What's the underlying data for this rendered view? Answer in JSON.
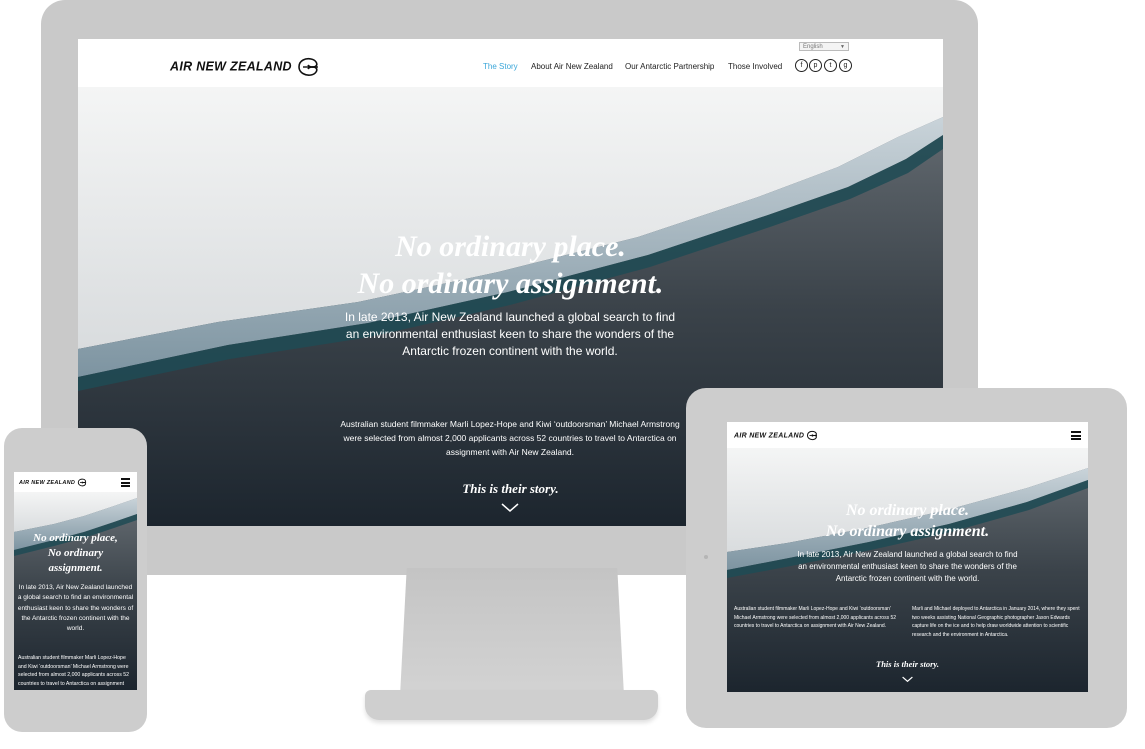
{
  "desktop": {
    "logo_text": "AIR NEW ZEALAND",
    "language_select": "English",
    "nav": [
      {
        "label": "The Story",
        "active": true
      },
      {
        "label": "About Air New Zealand",
        "active": false
      },
      {
        "label": "Our Antarctic Partnership",
        "active": false
      },
      {
        "label": "Those Involved",
        "active": false
      }
    ],
    "social_icons": [
      "facebook-icon",
      "pinterest-icon",
      "twitter-icon",
      "google-plus-icon"
    ],
    "headline_line1": "No ordinary place.",
    "headline_line2": "No ordinary assignment.",
    "intro": "In late 2013, Air New Zealand launched a global search to find an environmental enthusiast keen to share the wonders of the Antarctic frozen continent with the world.",
    "body": "Australian student filmmaker Marli Lopez-Hope and Kiwi ‘outdoorsman’ Michael Armstrong were selected from almost 2,000 applicants across 52 countries to travel to Antarctica on assignment with Air New Zealand.",
    "cta": "This is their story."
  },
  "tablet": {
    "logo_text": "AIR NEW ZEALAND",
    "headline_line1": "No ordinary place.",
    "headline_line2": "No ordinary assignment.",
    "intro": "In late 2013, Air New Zealand launched a global search to find an environmental enthusiast keen to share the wonders of the Antarctic frozen continent with the world.",
    "body_left": "Australian student filmmaker Marli Lopez-Hope and Kiwi ‘outdoorsman’ Michael Armstrong were selected from almost 2,000 applicants across 52 countries to travel to Antarctica on assignment with Air New Zealand.",
    "body_right": "Marli and Michael deployed to Antarctica in January 2014, where they spent two weeks assisting National Geographic photographer Jason Edwards capture life on the ice and to help draw worldwide attention to scientific research and the environment in Antarctica.",
    "cta": "This is their story."
  },
  "phone": {
    "logo_text": "AIR NEW ZEALAND",
    "headline_line1": "No ordinary place,",
    "headline_line2": "No ordinary",
    "headline_line3": "assignment.",
    "intro": "In late 2013, Air New Zealand launched a global search to find an environmental enthusiast keen to share the wonders of the Antarctic frozen continent with the world.",
    "body": "Australian student filmmaker Marli Lopez-Hope and Kiwi ‘outdoorsman’ Michael Armstrong were selected from almost 2,000 applicants across 52 countries to travel to Antarctica on assignment"
  },
  "colors": {
    "nav_active": "#3aa6d9",
    "device_frame": "#c9c9c9",
    "hero_dark": "#27303a"
  }
}
